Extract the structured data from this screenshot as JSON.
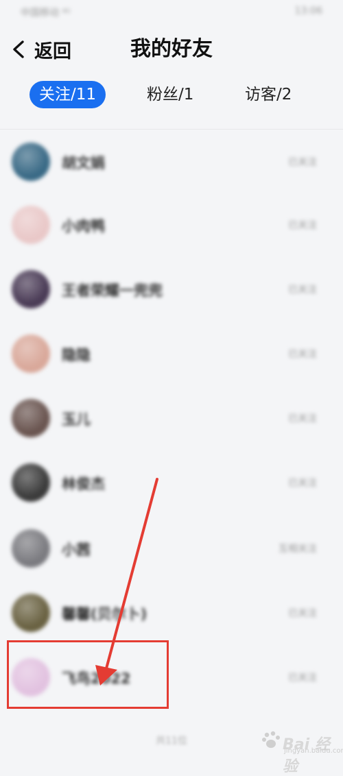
{
  "status_bar": {
    "carrier": "中国移动 ⁴ᴳ",
    "time": "13:06"
  },
  "header": {
    "back_label": "返回",
    "title": "我的好友"
  },
  "tabs": [
    {
      "label": "关注/11",
      "active": true
    },
    {
      "label": "粉丝/1",
      "active": false
    },
    {
      "label": "访客/2",
      "active": false
    }
  ],
  "friends": [
    {
      "name": "胡文娟",
      "status": "已关注",
      "avatar_color": "#3a6a86"
    },
    {
      "name": "小肉鸭",
      "status": "已关注",
      "avatar_color": "#e9c8c8"
    },
    {
      "name": "王者荣耀一兜兜",
      "status": "已关注",
      "avatar_color": "#4a3b56"
    },
    {
      "name": "隐隐",
      "status": "已关注",
      "avatar_color": "#d9a89a"
    },
    {
      "name": "玉儿",
      "status": "已关注",
      "avatar_color": "#6a5550"
    },
    {
      "name": "林俊杰",
      "status": "已关注",
      "avatar_color": "#3b3b3b"
    },
    {
      "name": "小茜",
      "status": "互相关注",
      "avatar_color": "#7b7b80"
    },
    {
      "name": "馨馨(贝尔卜)",
      "status": "已关注",
      "avatar_color": "#6a6242"
    },
    {
      "name": "飞鸟2022",
      "status": "已关注",
      "avatar_color": "#e2c2e0"
    }
  ],
  "footer_note": "共11位",
  "annotation": {
    "box_color": "#e43c33",
    "arrow_color": "#e43c33"
  },
  "watermark": {
    "brand": "Bai 经验",
    "url": "jingyan.baidu.com"
  },
  "colors": {
    "accent": "#1a6ff0",
    "background": "#f4f5f7"
  }
}
